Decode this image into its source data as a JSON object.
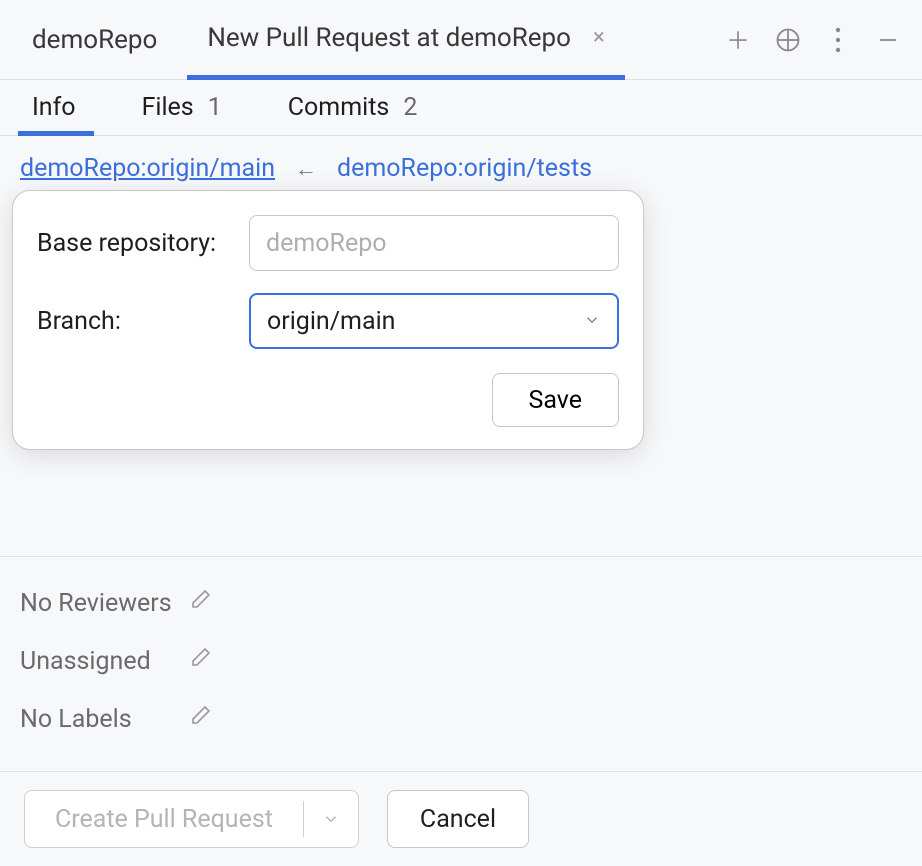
{
  "header": {
    "repo_tab": "demoRepo",
    "active_tab": "New Pull Request at demoRepo"
  },
  "subtabs": {
    "info": {
      "label": "Info"
    },
    "files": {
      "label": "Files",
      "count": "1"
    },
    "commits": {
      "label": "Commits",
      "count": "2"
    }
  },
  "branches": {
    "base": "demoRepo:origin/main",
    "compare": "demoRepo:origin/tests",
    "arrow": "←"
  },
  "popover": {
    "base_repo_label": "Base repository:",
    "base_repo_value": "demoRepo",
    "branch_label": "Branch:",
    "branch_value": "origin/main",
    "save": "Save"
  },
  "meta": {
    "reviewers": "No Reviewers",
    "assignee": "Unassigned",
    "labels": "No Labels"
  },
  "footer": {
    "create": "Create Pull Request",
    "cancel": "Cancel"
  }
}
